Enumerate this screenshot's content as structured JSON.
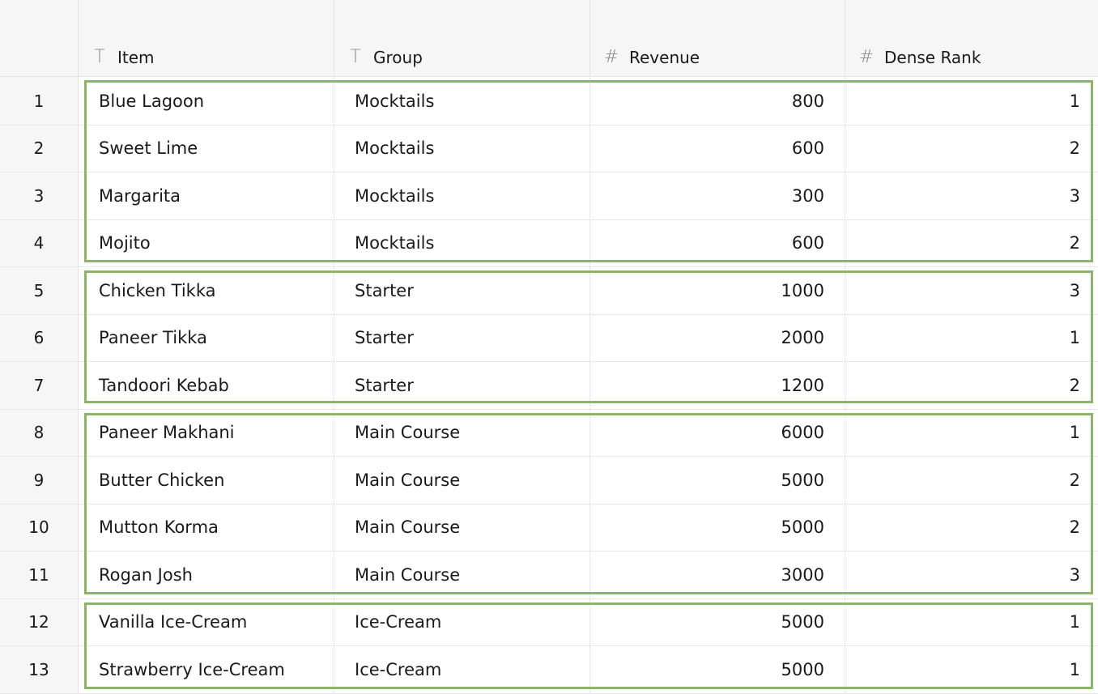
{
  "columns": [
    {
      "type_icon": "T",
      "label": "Item",
      "icon_name": "text-type-icon"
    },
    {
      "type_icon": "T",
      "label": "Group",
      "icon_name": "text-type-icon"
    },
    {
      "type_icon": "#",
      "label": "Revenue",
      "icon_name": "number-type-icon"
    },
    {
      "type_icon": "#",
      "label": "Dense Rank",
      "icon_name": "number-type-icon"
    }
  ],
  "rows": [
    {
      "n": "1",
      "item": "Blue Lagoon",
      "group": "Mocktails",
      "revenue": "800",
      "rank": "1"
    },
    {
      "n": "2",
      "item": "Sweet Lime",
      "group": "Mocktails",
      "revenue": "600",
      "rank": "2"
    },
    {
      "n": "3",
      "item": "Margarita",
      "group": "Mocktails",
      "revenue": "300",
      "rank": "3"
    },
    {
      "n": "4",
      "item": "Mojito",
      "group": "Mocktails",
      "revenue": "600",
      "rank": "2"
    },
    {
      "n": "5",
      "item": "Chicken Tikka",
      "group": "Starter",
      "revenue": "1000",
      "rank": "3"
    },
    {
      "n": "6",
      "item": "Paneer Tikka",
      "group": "Starter",
      "revenue": "2000",
      "rank": "1"
    },
    {
      "n": "7",
      "item": "Tandoori Kebab",
      "group": "Starter",
      "revenue": "1200",
      "rank": "2"
    },
    {
      "n": "8",
      "item": "Paneer Makhani",
      "group": "Main Course",
      "revenue": "6000",
      "rank": "1"
    },
    {
      "n": "9",
      "item": "Butter Chicken",
      "group": "Main Course",
      "revenue": "5000",
      "rank": "2"
    },
    {
      "n": "10",
      "item": "Mutton Korma",
      "group": "Main Course",
      "revenue": "5000",
      "rank": "2"
    },
    {
      "n": "11",
      "item": "Rogan Josh",
      "group": "Main Course",
      "revenue": "3000",
      "rank": "3"
    },
    {
      "n": "12",
      "item": "Vanilla Ice-Cream",
      "group": "Ice-Cream",
      "revenue": "5000",
      "rank": "1"
    },
    {
      "n": "13",
      "item": "Strawberry Ice-Cream",
      "group": "Ice-Cream",
      "revenue": "5000",
      "rank": "1"
    }
  ],
  "group_highlights": [
    {
      "group": "Mocktails",
      "first_row": 1,
      "last_row": 4
    },
    {
      "group": "Starter",
      "first_row": 5,
      "last_row": 7
    },
    {
      "group": "Main Course",
      "first_row": 8,
      "last_row": 11
    },
    {
      "group": "Ice-Cream",
      "first_row": 12,
      "last_row": 13
    }
  ],
  "colors": {
    "highlight_border": "#8db56a",
    "header_bg": "#f6f6f6",
    "gridline": "#e4e4e4"
  }
}
